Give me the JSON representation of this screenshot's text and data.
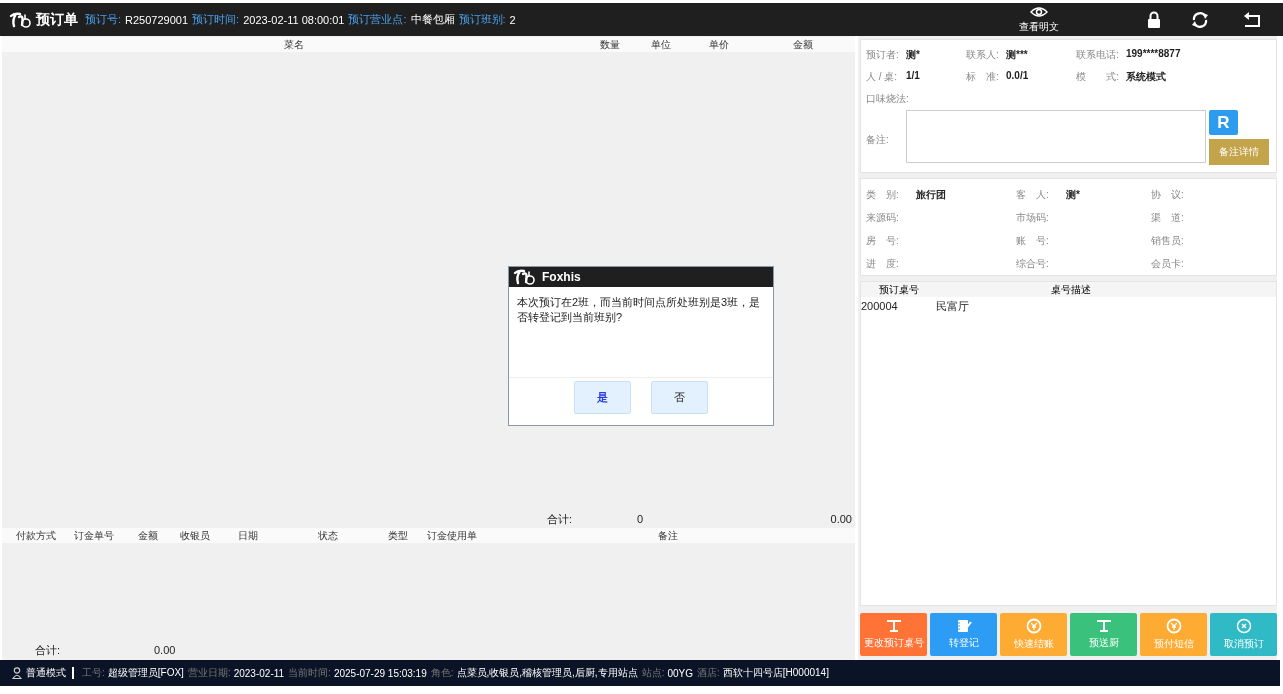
{
  "header": {
    "title": "预订单",
    "fields": [
      {
        "label": "预订号:",
        "value": "R250729001"
      },
      {
        "label": "预订时间:",
        "value": "2023-02-11 08:00:01"
      },
      {
        "label": "预订营业点:",
        "value": "中餐包厢"
      },
      {
        "label": "预订班别:",
        "value": "2"
      }
    ],
    "actions": [
      {
        "kind": "eye",
        "label": "查看明文"
      },
      {
        "kind": "lock"
      },
      {
        "kind": "refresh"
      },
      {
        "kind": "back"
      }
    ]
  },
  "dishes": {
    "columns": [
      "菜名",
      "数量",
      "单位",
      "单价",
      "金额"
    ],
    "total": {
      "label": "合计:",
      "count": "0",
      "amount": "0.00"
    }
  },
  "payments": {
    "columns": [
      "付款方式",
      "订金单号",
      "金额",
      "收银员",
      "日期",
      "状态",
      "类型",
      "订金使用单",
      "备注"
    ],
    "total": {
      "label": "合计:",
      "amount": "0.00"
    }
  },
  "booking_info": {
    "rows": [
      [
        {
          "label": "预订者:",
          "value": "测*"
        },
        {
          "label": "联系人:",
          "value": "测***"
        },
        {
          "label": "联系电话:",
          "value": "199****8877"
        }
      ],
      [
        {
          "label": "人 / 桌:",
          "value": "1/1"
        },
        {
          "label": "标　准:",
          "value": "0.0/1"
        },
        {
          "label": "模　　式:",
          "value": "系统模式"
        }
      ]
    ],
    "taste_label": "口味烧法:",
    "remark_label": "备注:",
    "r_button": "R",
    "detail_button": "备注详情"
  },
  "guest_info": {
    "rows": [
      [
        {
          "label": "类　别:",
          "value": "旅行团"
        },
        {
          "label": "客　人:",
          "value": "测*"
        },
        {
          "label": "协　议:"
        }
      ],
      [
        {
          "label": "来源码:"
        },
        {
          "label": "市场码:"
        },
        {
          "label": "渠　道:"
        }
      ],
      [
        {
          "label": "房　号:"
        },
        {
          "label": "账　号:"
        },
        {
          "label": "销售员:"
        }
      ],
      [
        {
          "label": "进　度:"
        },
        {
          "label": "综合号:"
        },
        {
          "label": "会员卡:"
        }
      ]
    ]
  },
  "tables": {
    "columns": [
      "预订桌号",
      "桌号描述"
    ],
    "rows": [
      [
        "200004",
        "民富厅"
      ]
    ]
  },
  "actions": [
    {
      "label": "更改预订桌号",
      "kind": "tee",
      "color": "#ff7337"
    },
    {
      "label": "转登记",
      "kind": "notebook",
      "color": "#2d9cf4"
    },
    {
      "label": "快速结账",
      "kind": "yen",
      "color": "#fdab33"
    },
    {
      "label": "预送厨",
      "kind": "tee",
      "color": "#3ac27d"
    },
    {
      "label": "预付短信",
      "kind": "yen",
      "color": "#fdab33"
    },
    {
      "label": "取消预订",
      "kind": "cancel",
      "color": "#2fbac6"
    }
  ],
  "status_bar": {
    "mode": "普通模式",
    "fields": [
      {
        "label": "工号:",
        "value": "超级管理员[FOX]"
      },
      {
        "label": "营业日期:",
        "value": "2023-02-11"
      },
      {
        "label": "当前时间:",
        "value": "2025-07-29 15:03:19"
      },
      {
        "label": "角色:",
        "value": "点菜员,收银员,稽核管理员,后厨,专用站点"
      },
      {
        "label": "站点:",
        "value": "00YG"
      },
      {
        "label": "酒店:",
        "value": "西软十四号店[H000014]"
      }
    ]
  },
  "dialog": {
    "title": "Foxhis",
    "message": "本次预订在2班，而当前时间点所处班别是3班，是否转登记到当前班别?",
    "buttons": [
      {
        "label": "是",
        "selected": true
      },
      {
        "label": "否",
        "selected": false
      }
    ]
  }
}
